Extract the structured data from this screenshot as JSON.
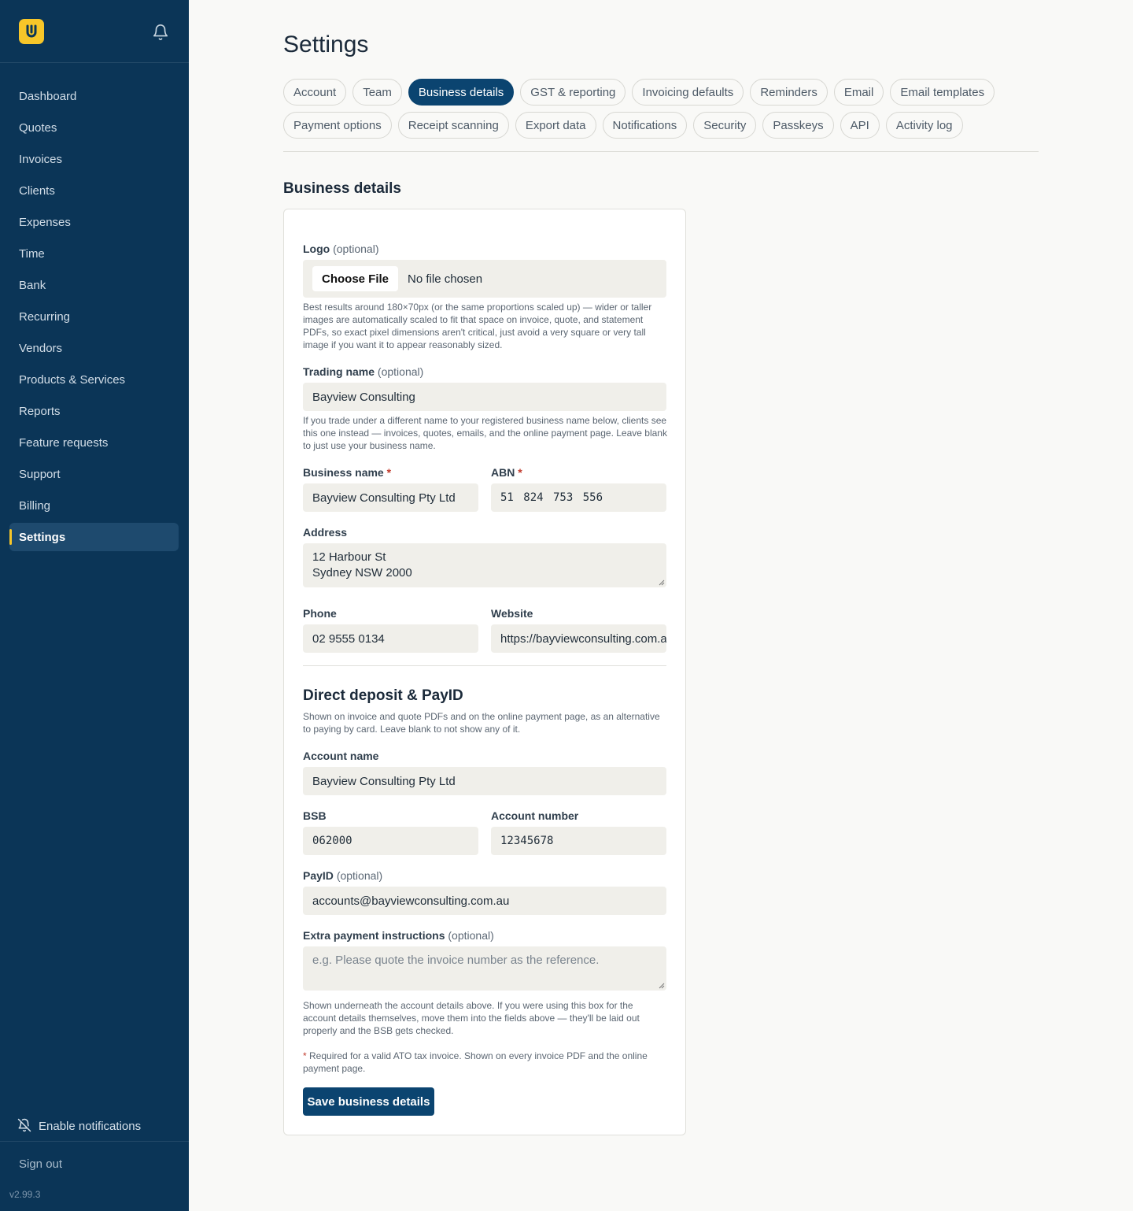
{
  "sidebar": {
    "logo_letter": "U",
    "items": [
      {
        "label": "Dashboard"
      },
      {
        "label": "Quotes"
      },
      {
        "label": "Invoices"
      },
      {
        "label": "Clients"
      },
      {
        "label": "Expenses"
      },
      {
        "label": "Time"
      },
      {
        "label": "Bank"
      },
      {
        "label": "Recurring"
      },
      {
        "label": "Vendors"
      },
      {
        "label": "Products & Services"
      },
      {
        "label": "Reports"
      },
      {
        "label": "Feature requests"
      },
      {
        "label": "Support"
      },
      {
        "label": "Billing"
      },
      {
        "label": "Settings"
      }
    ],
    "active_item": "Settings",
    "enable_notifications": "Enable notifications",
    "sign_out": "Sign out",
    "version": "v2.99.3"
  },
  "page": {
    "title": "Settings",
    "tabs_row1": [
      "Account",
      "Team",
      "Business details",
      "GST & reporting",
      "Invoicing defaults",
      "Reminders",
      "Email",
      "Email templates"
    ],
    "tabs_row2": [
      "Payment options",
      "Receipt scanning",
      "Export data",
      "Notifications",
      "Security",
      "Passkeys",
      "API",
      "Activity log"
    ],
    "active_tab": "Business details",
    "section_title": "Business details"
  },
  "form": {
    "logo": {
      "label": "Logo",
      "optional": "(optional)",
      "button": "Choose File",
      "status": "No file chosen",
      "help": "Best results around 180×70px (or the same proportions scaled up) — wider or taller images are automatically scaled to fit that space on invoice, quote, and statement PDFs, so exact pixel dimensions aren't critical, just avoid a very square or very tall image if you want it to appear reasonably sized."
    },
    "trading_name": {
      "label": "Trading name",
      "optional": "(optional)",
      "value": "Bayview Consulting",
      "help": "If you trade under a different name to your registered business name below, clients see this one instead — invoices, quotes, emails, and the online payment page. Leave blank to just use your business name."
    },
    "business_name": {
      "label": "Business name",
      "required": "*",
      "value": "Bayview Consulting Pty Ltd"
    },
    "abn": {
      "label": "ABN",
      "required": "*",
      "value": "51 824 753 556"
    },
    "address": {
      "label": "Address",
      "line1": "12 Harbour St",
      "line2": "Sydney NSW 2000"
    },
    "phone": {
      "label": "Phone",
      "value": "02 9555 0134"
    },
    "website": {
      "label": "Website",
      "value": "https://bayviewconsulting.com.au"
    },
    "direct_deposit": {
      "title": "Direct deposit & PayID",
      "help": "Shown on invoice and quote PDFs and on the online payment page, as an alternative to paying by card. Leave blank to not show any of it."
    },
    "account_name": {
      "label": "Account name",
      "value": "Bayview Consulting Pty Ltd"
    },
    "bsb": {
      "label": "BSB",
      "value": "062000"
    },
    "account_number": {
      "label": "Account number",
      "value": "12345678"
    },
    "payid": {
      "label": "PayID",
      "optional": "(optional)",
      "value": "accounts@bayviewconsulting.com.au"
    },
    "extra_instructions": {
      "label": "Extra payment instructions",
      "optional": "(optional)",
      "placeholder": "e.g. Please quote the invoice number as the reference.",
      "help": "Shown underneath the account details above. If you were using this box for the account details themselves, move them into the fields above — they'll be laid out properly and the BSB gets checked."
    },
    "required_note_star": "*",
    "required_note": "Required for a valid ATO tax invoice. Shown on every invoice PDF and the online payment page.",
    "save_button": "Save business details"
  },
  "colors": {
    "sidebar_bg": "#0b3557",
    "accent_yellow": "#f7c629",
    "primary": "#0b4470",
    "required": "#c0392b"
  },
  "icons": {
    "logo": "brand-logo-icon",
    "bell": "bell-icon",
    "bell_off": "bell-off-icon"
  }
}
